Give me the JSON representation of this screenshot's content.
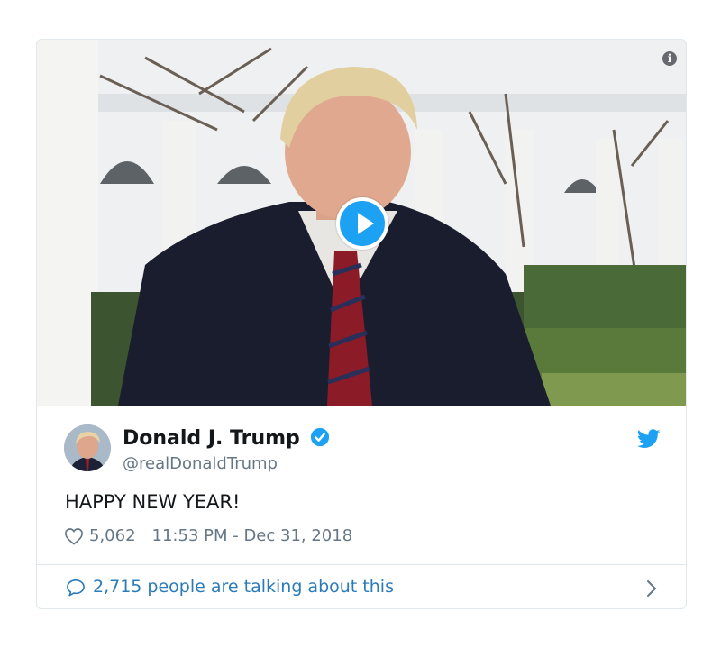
{
  "media": {
    "info_icon": "info-icon",
    "play_icon": "play-icon"
  },
  "tweet": {
    "author_name": "Donald J. Trump",
    "handle": "@realDonaldTrump",
    "text": "HAPPY NEW YEAR!",
    "likes": "5,062",
    "timestamp": "11:53 PM - Dec 31, 2018",
    "talking_about": "2,715 people are talking about this"
  },
  "colors": {
    "twitter_blue": "#1da1f2",
    "link_blue": "#2b7bb9",
    "secondary_text": "#657786"
  }
}
